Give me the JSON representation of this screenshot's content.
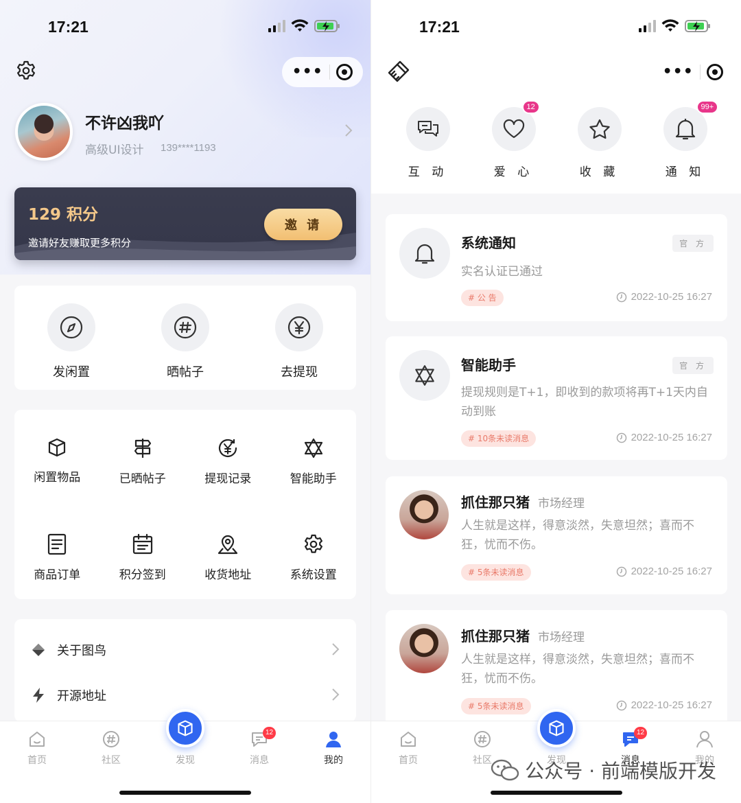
{
  "status_bar": {
    "time": "17:21"
  },
  "left": {
    "profile": {
      "name": "不许凶我吖",
      "role": "高级UI设计",
      "phone": "139****1193"
    },
    "points": {
      "value_text": "129 积分",
      "subtitle": "邀请好友赚取更多积分",
      "invite_label": "邀 请"
    },
    "quick_actions": [
      {
        "label": "发闲置",
        "icon": "compass-icon"
      },
      {
        "label": "晒帖子",
        "icon": "hashtag-icon"
      },
      {
        "label": "去提现",
        "icon": "yen-icon"
      }
    ],
    "grid": [
      {
        "label": "闲置物品",
        "icon": "box-icon"
      },
      {
        "label": "已晒帖子",
        "icon": "signpost-icon"
      },
      {
        "label": "提现记录",
        "icon": "yen-history-icon"
      },
      {
        "label": "智能助手",
        "icon": "star-of-david-icon"
      },
      {
        "label": "商品订单",
        "icon": "order-list-icon"
      },
      {
        "label": "积分签到",
        "icon": "calendar-icon"
      },
      {
        "label": "收货地址",
        "icon": "map-pin-icon"
      },
      {
        "label": "系统设置",
        "icon": "gear-icon"
      }
    ],
    "list": [
      {
        "label": "关于图鸟",
        "icon": "diamond-icon"
      },
      {
        "label": "开源地址",
        "icon": "lightning-icon"
      }
    ]
  },
  "tabbar": {
    "items": [
      {
        "label": "首页"
      },
      {
        "label": "社区"
      },
      {
        "label": "发现"
      },
      {
        "label": "消息",
        "badge": "12"
      },
      {
        "label": "我的"
      }
    ]
  },
  "right": {
    "categories": [
      {
        "label": "互 动",
        "icon": "chat-bubbles-icon"
      },
      {
        "label": "爱 心",
        "icon": "heart-icon",
        "badge": "12"
      },
      {
        "label": "收 藏",
        "icon": "star-icon"
      },
      {
        "label": "通 知",
        "icon": "bell-icon",
        "badge": "99+"
      }
    ],
    "messages": [
      {
        "title": "系统通知",
        "official": "官 方",
        "body": "实名认证已通过",
        "tag": "# 公 告",
        "time": "2022-10-25 16:27"
      },
      {
        "title": "智能助手",
        "official": "官 方",
        "body": "提现规则是T+1，即收到的款项将再T+1天内自动到账",
        "tag": "# 10条未读消息",
        "time": "2022-10-25 16:27"
      },
      {
        "title": "抓住那只猪",
        "subtitle": "市场经理",
        "body": "人生就是这样，得意淡然，失意坦然；喜而不狂，忧而不伤。",
        "tag": "# 5条未读消息",
        "time": "2022-10-25 16:27"
      },
      {
        "title": "抓住那只猪",
        "subtitle": "市场经理",
        "body": "人生就是这样，得意淡然，失意坦然；喜而不狂，忧而不伤。",
        "tag": "# 5条未读消息",
        "time": "2022-10-25 16:27"
      }
    ]
  },
  "watermark": "公众号 · 前端模版开发",
  "colors": {
    "accent_blue": "#3066f0",
    "badge_red": "#ff3b47",
    "badge_pink": "#e8368a",
    "gold": "#f4c88a"
  }
}
